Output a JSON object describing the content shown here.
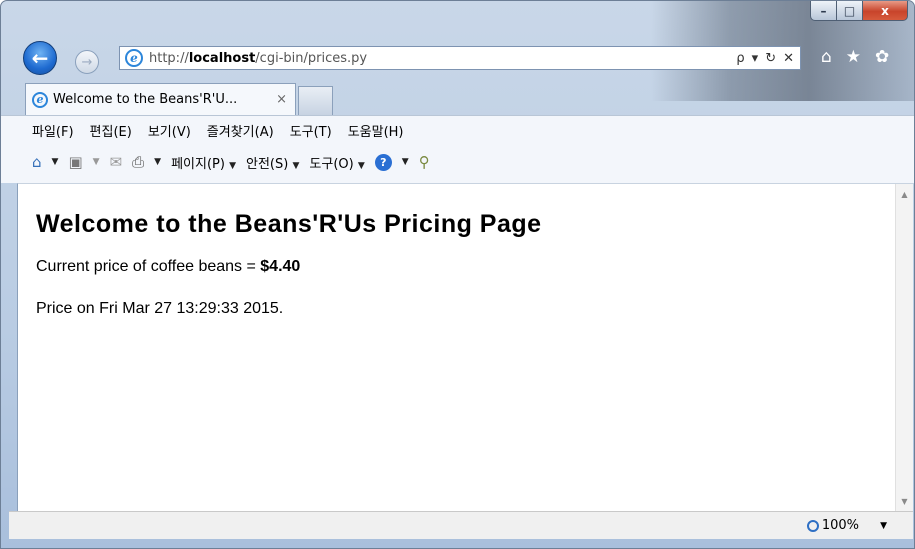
{
  "window": {
    "caption_buttons": {
      "minimize": "–",
      "maximize": "□",
      "close": "x"
    }
  },
  "nav": {
    "back_icon": "back-arrow-icon",
    "forward_icon": "forward-arrow-icon",
    "url_prefix": "http://",
    "url_host": "localhost",
    "url_path": "/cgi-bin/prices.py",
    "search_glyph": "ρ",
    "dropdown_glyph": "▾",
    "refresh_glyph": "↻",
    "stop_glyph": "✕"
  },
  "toolbar_right": {
    "home": "⌂",
    "favorites": "★",
    "tools": "✿"
  },
  "tab": {
    "title": "Welcome to the Beans'R'U...",
    "close": "×"
  },
  "menu": {
    "items": [
      "파일(F)",
      "편집(E)",
      "보기(V)",
      "즐겨찾기(A)",
      "도구(T)",
      "도움말(H)"
    ]
  },
  "commandbar": {
    "page": "페이지(P)",
    "safety": "안전(S)",
    "tools": "도구(O)"
  },
  "page": {
    "heading": "Welcome to the Beans'R'Us Pricing Page",
    "price_label": "Current price of coffee beans = ",
    "price_value": "$4.40",
    "date_line": "Price on Fri Mar 27 13:29:33 2015."
  },
  "status": {
    "zoom": "100%"
  }
}
